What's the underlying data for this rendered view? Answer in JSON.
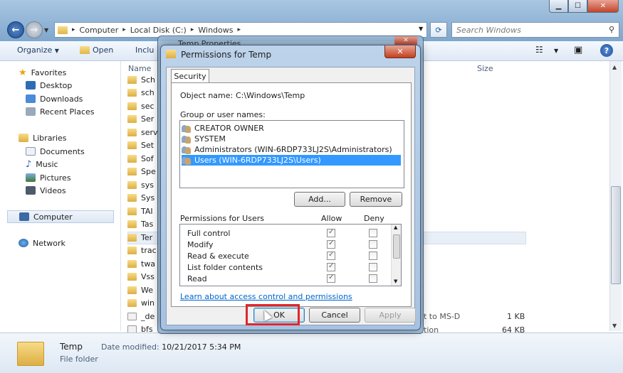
{
  "explorer": {
    "address": {
      "crumbs": [
        "Computer",
        "Local Disk (C:)",
        "Windows"
      ]
    },
    "search_placeholder": "Search Windows",
    "toolbar": {
      "organize": "Organize",
      "open": "Open",
      "include": "Inclu"
    },
    "columns": {
      "name": "Name",
      "size": "Size"
    },
    "nav": {
      "favorites": "Favorites",
      "desktop": "Desktop",
      "downloads": "Downloads",
      "recent": "Recent Places",
      "libraries": "Libraries",
      "documents": "Documents",
      "music": "Music",
      "pictures": "Pictures",
      "videos": "Videos",
      "computer": "Computer",
      "network": "Network"
    },
    "files": [
      "Sch",
      "sch",
      "sec",
      "Ser",
      "serv",
      "Set",
      "Sof",
      "Spe",
      "sys",
      "Sys",
      "TAI",
      "Tas",
      "Ter",
      "trac",
      "twa",
      "Vss",
      "We",
      "win",
      "_de",
      "bfs"
    ],
    "partial_type": {
      "line1": "t to MS-D",
      "line2": "tion"
    },
    "sizes": {
      "row1": "1 KB",
      "row2": "64 KB"
    },
    "details": {
      "name": "Temp",
      "type": "File folder",
      "modified_label": "Date modified:",
      "modified_value": "10/21/2017 5:34 PM"
    }
  },
  "properties_dialog": {
    "title": "Temp Properties"
  },
  "permissions_dialog": {
    "title": "Permissions for Temp",
    "close_glyph": "✕",
    "tab": "Security",
    "object_label": "Object name:",
    "object_value": "C:\\Windows\\Temp",
    "group_label": "Group or user names:",
    "users": [
      "CREATOR OWNER",
      "SYSTEM",
      "Administrators (WIN-6RDP733LJ2S\\Administrators)",
      "Users (WIN-6RDP733LJ2S\\Users)"
    ],
    "add_button": "Add...",
    "remove_button": "Remove",
    "perm_label": "Permissions for Users",
    "allow_header": "Allow",
    "deny_header": "Deny",
    "permissions": [
      "Full control",
      "Modify",
      "Read & execute",
      "List folder contents",
      "Read"
    ],
    "link": "Learn about access control and permissions",
    "ok_button": "OK",
    "cancel_button": "Cancel",
    "apply_button": "Apply"
  }
}
